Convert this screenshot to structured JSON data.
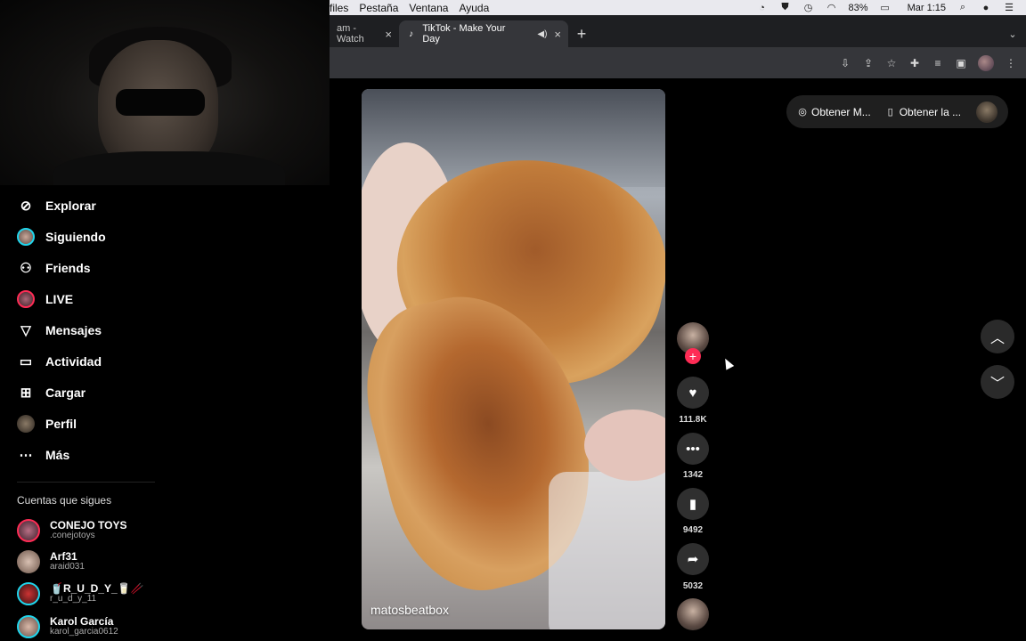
{
  "menubar": {
    "items": [
      "files",
      "Pestaña",
      "Ventana",
      "Ayuda"
    ],
    "battery": "83%",
    "clock": "Mar 1:15"
  },
  "tabs": {
    "inactive": "am - Watch",
    "active": "TikTok - Make Your Day"
  },
  "sidebar": {
    "items": [
      {
        "label": "Explorar",
        "icon": "compass-icon"
      },
      {
        "label": "Siguiendo",
        "icon": "avatar"
      },
      {
        "label": "Friends",
        "icon": "friends-icon"
      },
      {
        "label": "LIVE",
        "icon": "live-icon"
      },
      {
        "label": "Mensajes",
        "icon": "send-icon"
      },
      {
        "label": "Actividad",
        "icon": "inbox-icon"
      },
      {
        "label": "Cargar",
        "icon": "plus-square-icon"
      },
      {
        "label": "Perfil",
        "icon": "avatar"
      },
      {
        "label": "Más",
        "icon": "more-icon"
      }
    ],
    "following_title": "Cuentas que sigues",
    "accounts": [
      {
        "name": "CONEJO TOYS",
        "handle": ".conejotoys"
      },
      {
        "name": "Arf31",
        "handle": "araid031"
      },
      {
        "name": "🥤R_U_D_Y_🥛🥢",
        "handle": "r_u_d_y_11"
      },
      {
        "name": "Karol García",
        "handle": "karol_garcia0612"
      }
    ]
  },
  "video": {
    "author": "matosbeatbox"
  },
  "actions": {
    "likes": "111.8K",
    "comments": "1342",
    "saves": "9492",
    "shares": "5032"
  },
  "getapp": {
    "desktop": "Obtener M...",
    "mobile": "Obtener la ..."
  },
  "colors": {
    "accent": "#fe2c55",
    "ring": "#20d5ec"
  }
}
